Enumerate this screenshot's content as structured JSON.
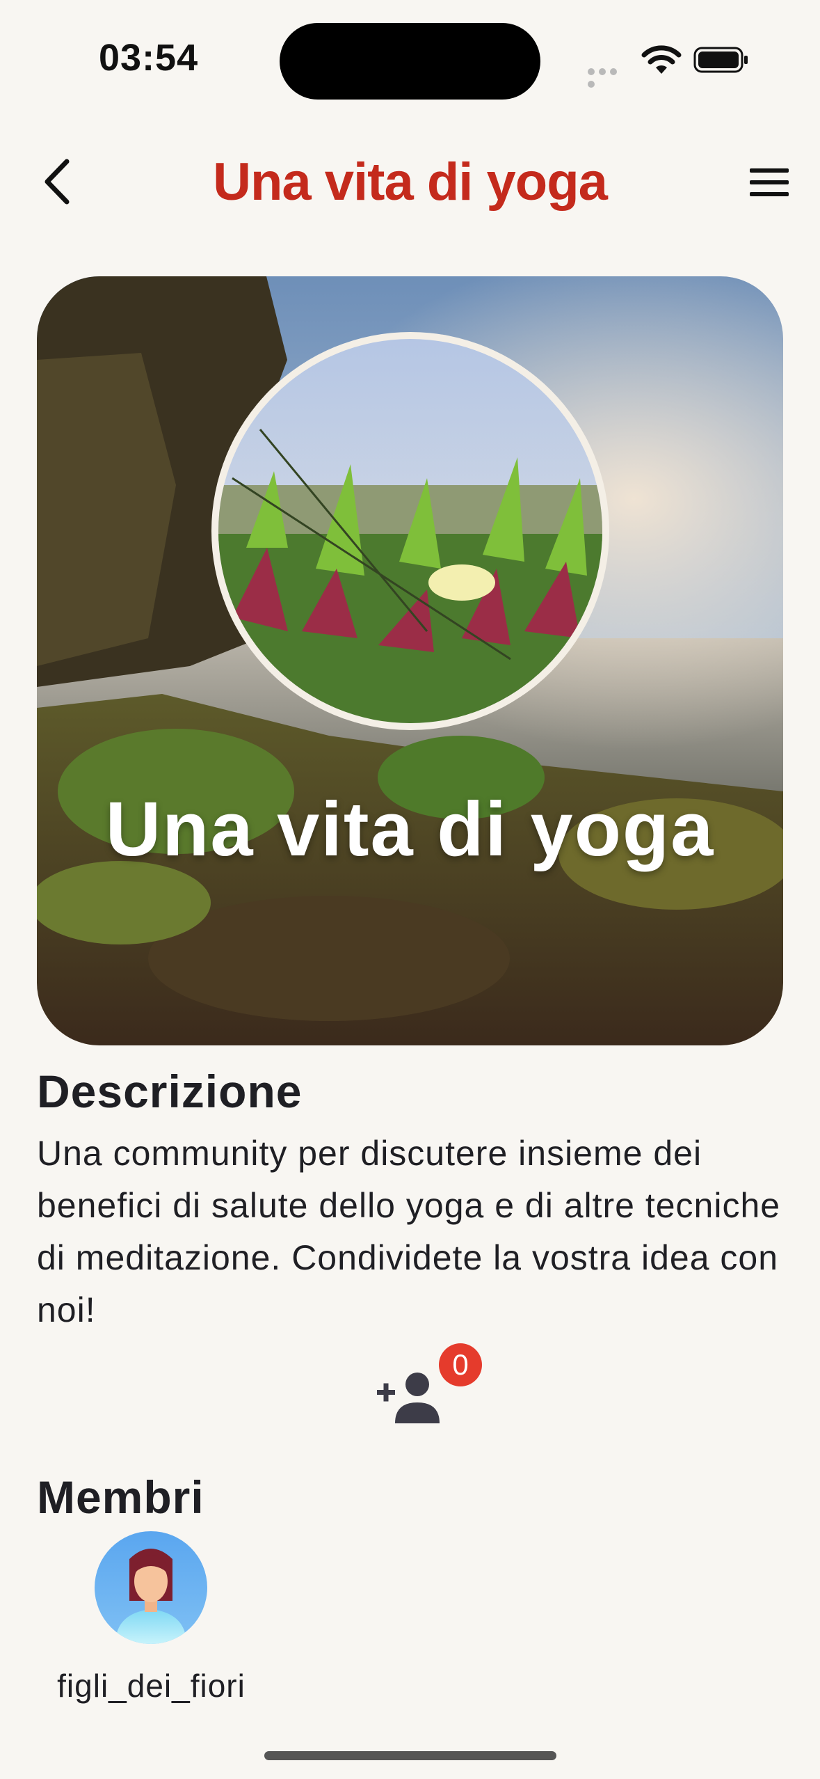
{
  "status": {
    "time": "03:54"
  },
  "nav": {
    "title": "Una vita di yoga"
  },
  "hero": {
    "title": "Una vita di yoga"
  },
  "description": {
    "heading": "Descrizione",
    "text": "Una community per discutere insieme dei benefici di salute dello yoga e di altre tecniche di meditazione. Condividete la vostra idea con noi!"
  },
  "join": {
    "icon": "person-add-icon",
    "count": "0"
  },
  "members": {
    "heading": "Membri",
    "items": [
      {
        "name": "figli_dei_fiori"
      }
    ]
  },
  "colors": {
    "accent": "#c42a1c",
    "badge": "#e53b2c",
    "background": "#f8f6f2"
  }
}
